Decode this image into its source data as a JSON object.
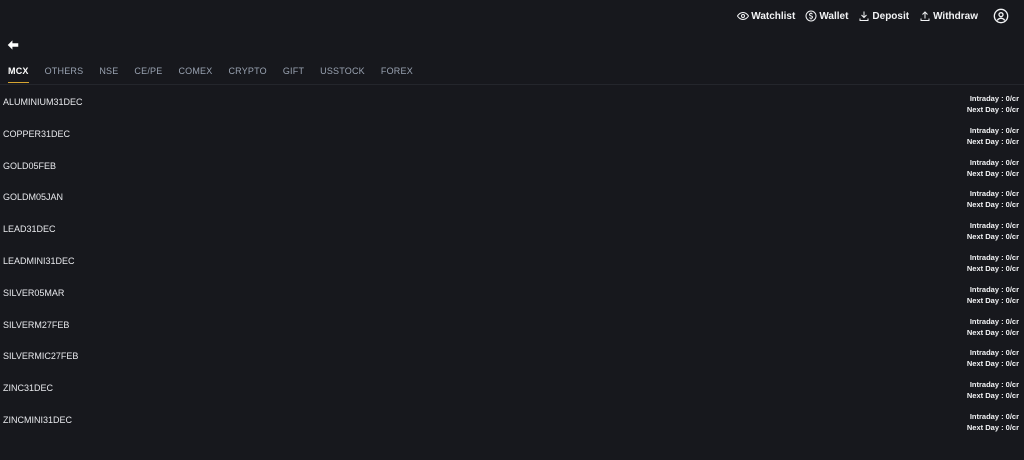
{
  "top_actions": [
    {
      "label": "Watchlist",
      "icon": "eye-icon"
    },
    {
      "label": "Wallet",
      "icon": "dollar-coin-icon"
    },
    {
      "label": "Deposit",
      "icon": "download-icon"
    },
    {
      "label": "Withdraw",
      "icon": "upload-icon"
    }
  ],
  "tabs": [
    "MCX",
    "OTHERS",
    "NSE",
    "CE/PE",
    "COMEX",
    "CRYPTO",
    "GIFT",
    "USSTOCK",
    "FOREX"
  ],
  "active_tab": "MCX",
  "rows": [
    {
      "symbol": "ALUMINIUM31DEC",
      "intraday": "Intraday : 0/cr",
      "next_day": "Next Day : 0/cr"
    },
    {
      "symbol": "COPPER31DEC",
      "intraday": "Intraday : 0/cr",
      "next_day": "Next Day : 0/cr"
    },
    {
      "symbol": "GOLD05FEB",
      "intraday": "Intraday : 0/cr",
      "next_day": "Next Day : 0/cr"
    },
    {
      "symbol": "GOLDM05JAN",
      "intraday": "Intraday : 0/cr",
      "next_day": "Next Day : 0/cr"
    },
    {
      "symbol": "LEAD31DEC",
      "intraday": "Intraday : 0/cr",
      "next_day": "Next Day : 0/cr"
    },
    {
      "symbol": "LEADMINI31DEC",
      "intraday": "Intraday : 0/cr",
      "next_day": "Next Day : 0/cr"
    },
    {
      "symbol": "SILVER05MAR",
      "intraday": "Intraday : 0/cr",
      "next_day": "Next Day : 0/cr"
    },
    {
      "symbol": "SILVERM27FEB",
      "intraday": "Intraday : 0/cr",
      "next_day": "Next Day : 0/cr"
    },
    {
      "symbol": "SILVERMIC27FEB",
      "intraday": "Intraday : 0/cr",
      "next_day": "Next Day : 0/cr"
    },
    {
      "symbol": "ZINC31DEC",
      "intraday": "Intraday : 0/cr",
      "next_day": "Next Day : 0/cr"
    },
    {
      "symbol": "ZINCMINI31DEC",
      "intraday": "Intraday : 0/cr",
      "next_day": "Next Day : 0/cr"
    }
  ],
  "colors": {
    "background": "#17181d",
    "active_tab_underline": "#d6a531",
    "inactive_tab": "#9aa3b2"
  }
}
